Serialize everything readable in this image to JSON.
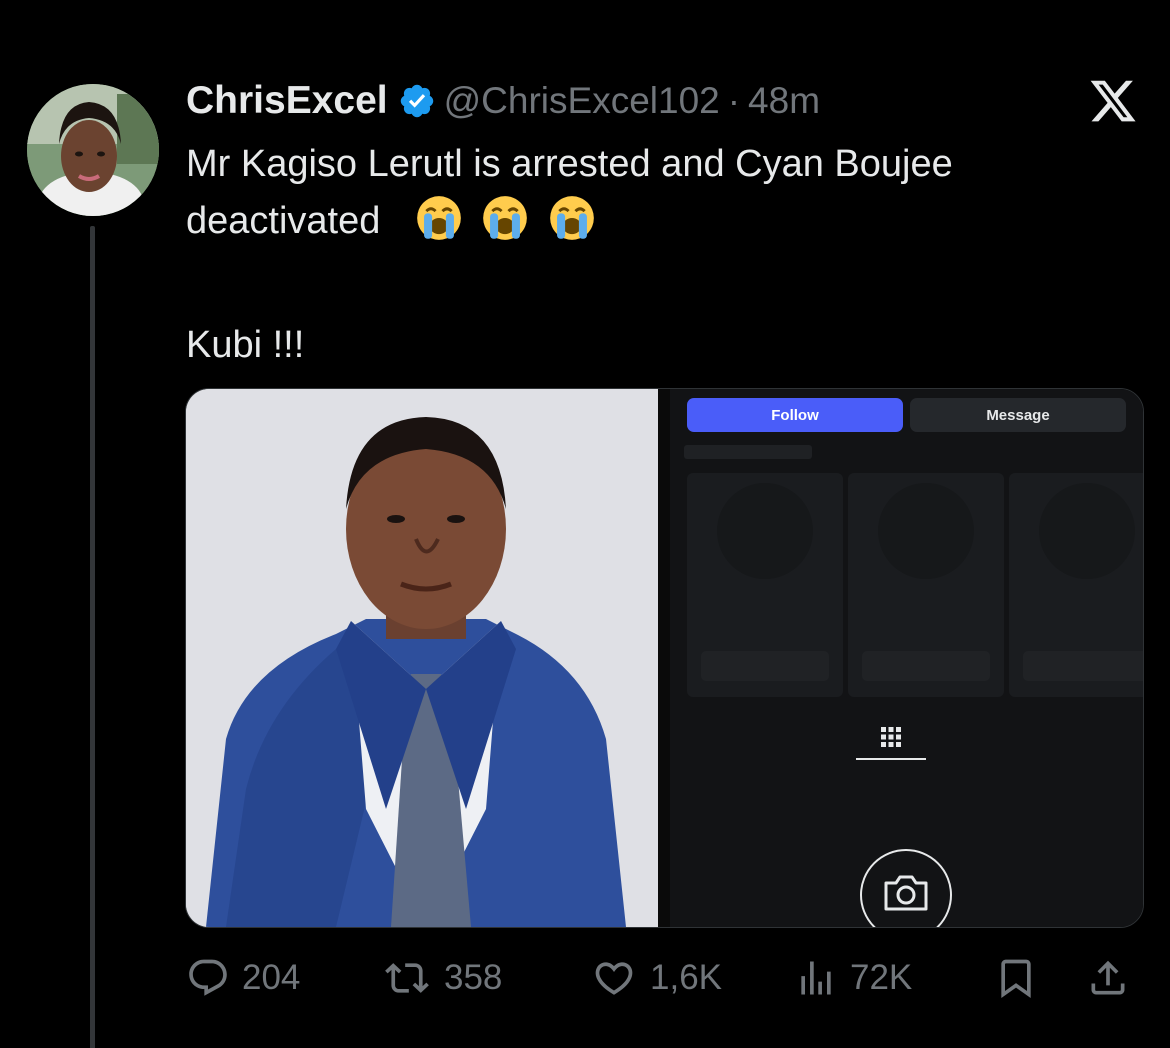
{
  "tweet": {
    "display_name": "ChrisExcel",
    "handle": "@ChrisExcel102",
    "separator": "·",
    "time": "48m",
    "text_line1": "Mr Kagiso Lerutl is arrested and Cyan Boujee",
    "text_line2": "deactivated",
    "text_line3": "Kubi !!!",
    "emojis": [
      "loudly-crying-face",
      "loudly-crying-face",
      "loudly-crying-face"
    ]
  },
  "media": {
    "profile_screenshot": {
      "follow_label": "Follow",
      "message_label": "Message"
    }
  },
  "actions": {
    "replies": "204",
    "reposts": "358",
    "likes": "1,6K",
    "views": "72K"
  },
  "colors": {
    "background": "#000000",
    "text": "#e7e9ea",
    "muted": "#71767b",
    "verified": "#1d9bf0",
    "follow_button": "#4a5df9"
  },
  "icons": [
    "verified-badge-icon",
    "x-logo-icon",
    "reply-icon",
    "repost-icon",
    "like-icon",
    "views-icon",
    "bookmark-icon",
    "share-icon",
    "grid-icon",
    "camera-icon"
  ]
}
